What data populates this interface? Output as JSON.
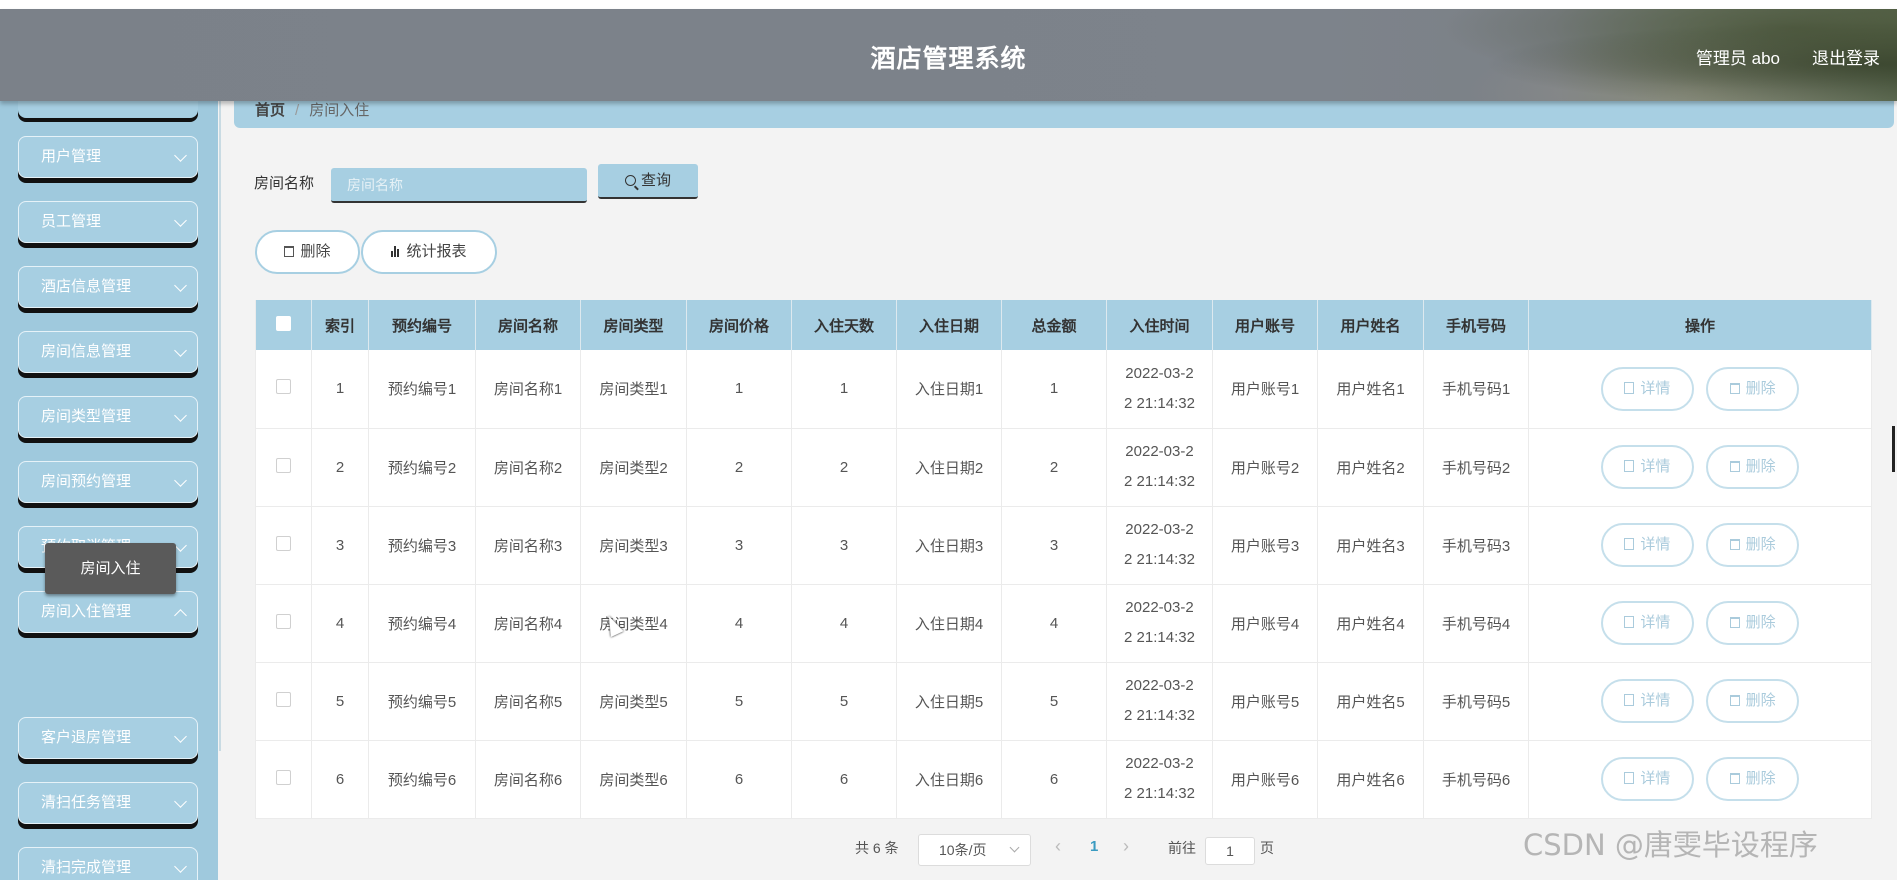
{
  "header": {
    "title": "酒店管理系统",
    "user_label": "管理员 abo",
    "logout_label": "退出登录"
  },
  "sidebar": {
    "items": [
      {
        "label": "用户管理"
      },
      {
        "label": "员工管理"
      },
      {
        "label": "酒店信息管理"
      },
      {
        "label": "房间信息管理"
      },
      {
        "label": "房间类型管理"
      },
      {
        "label": "房间预约管理"
      },
      {
        "label": "预约取消管理"
      },
      {
        "label": "房间入住管理"
      },
      {
        "label": "客户退房管理"
      },
      {
        "label": "清扫任务管理"
      },
      {
        "label": "清扫完成管理"
      }
    ],
    "active_sub": "房间入住"
  },
  "breadcrumb": {
    "home": "首页",
    "separator": "/",
    "current": "房间入住"
  },
  "search": {
    "label": "房间名称",
    "placeholder": "房间名称",
    "button_label": "查询"
  },
  "actions": {
    "delete_label": "删除",
    "stats_label": "统计报表"
  },
  "table": {
    "columns": [
      "索引",
      "预约编号",
      "房间名称",
      "房间类型",
      "房间价格",
      "入住天数",
      "入住日期",
      "总金额",
      "入住时间",
      "用户账号",
      "用户姓名",
      "手机号码",
      "操作"
    ],
    "rows": [
      {
        "idx": "1",
        "code": "预约编号1",
        "name": "房间名称1",
        "type": "房间类型1",
        "price": "1",
        "days": "1",
        "date": "入住日期1",
        "total": "1",
        "time1": "2022-03-2",
        "time2": "2 21:14:32",
        "account": "用户账号1",
        "uname": "用户姓名1",
        "phone": "手机号码1"
      },
      {
        "idx": "2",
        "code": "预约编号2",
        "name": "房间名称2",
        "type": "房间类型2",
        "price": "2",
        "days": "2",
        "date": "入住日期2",
        "total": "2",
        "time1": "2022-03-2",
        "time2": "2 21:14:32",
        "account": "用户账号2",
        "uname": "用户姓名2",
        "phone": "手机号码2"
      },
      {
        "idx": "3",
        "code": "预约编号3",
        "name": "房间名称3",
        "type": "房间类型3",
        "price": "3",
        "days": "3",
        "date": "入住日期3",
        "total": "3",
        "time1": "2022-03-2",
        "time2": "2 21:14:32",
        "account": "用户账号3",
        "uname": "用户姓名3",
        "phone": "手机号码3"
      },
      {
        "idx": "4",
        "code": "预约编号4",
        "name": "房间名称4",
        "type": "房间类型4",
        "price": "4",
        "days": "4",
        "date": "入住日期4",
        "total": "4",
        "time1": "2022-03-2",
        "time2": "2 21:14:32",
        "account": "用户账号4",
        "uname": "用户姓名4",
        "phone": "手机号码4"
      },
      {
        "idx": "5",
        "code": "预约编号5",
        "name": "房间名称5",
        "type": "房间类型5",
        "price": "5",
        "days": "5",
        "date": "入住日期5",
        "total": "5",
        "time1": "2022-03-2",
        "time2": "2 21:14:32",
        "account": "用户账号5",
        "uname": "用户姓名5",
        "phone": "手机号码5"
      },
      {
        "idx": "6",
        "code": "预约编号6",
        "name": "房间名称6",
        "type": "房间类型6",
        "price": "6",
        "days": "6",
        "date": "入住日期6",
        "total": "6",
        "time1": "2022-03-2",
        "time2": "2 21:14:32",
        "account": "用户账号6",
        "uname": "用户姓名6",
        "phone": "手机号码6"
      }
    ],
    "detail_label": "详情",
    "delete_label": "删除"
  },
  "pagination": {
    "total_text": "共 6 条",
    "page_size": "10条/页",
    "current_page": "1",
    "goto_label": "前往",
    "goto_value": "1",
    "page_unit": "页"
  },
  "watermark": "CSDN @唐雯毕设程序",
  "colors": {
    "accent": "#a7cfe2",
    "sidebar": "#9fc9dd",
    "header": "#7d838b",
    "active": "#5a5a5a"
  }
}
